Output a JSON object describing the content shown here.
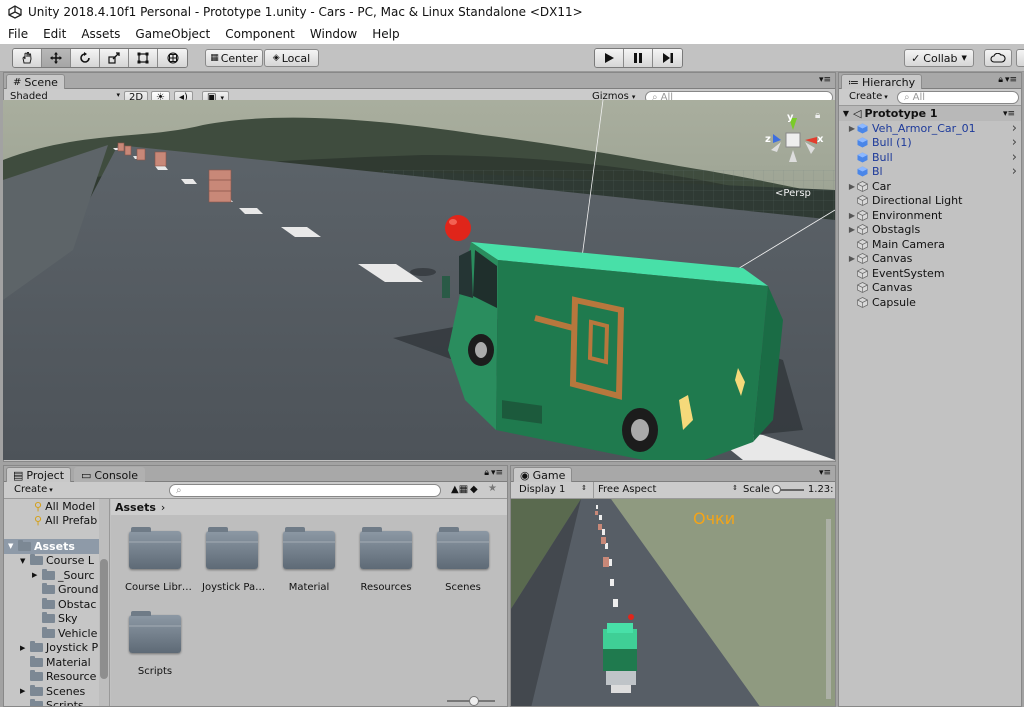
{
  "window": {
    "title": "Unity 2018.4.10f1 Personal - Prototype 1.unity - Cars - PC, Mac & Linux Standalone <DX11>"
  },
  "menu": [
    "File",
    "Edit",
    "Assets",
    "GameObject",
    "Component",
    "Window",
    "Help"
  ],
  "toolbar": {
    "pivot_label": "Center",
    "space_label": "Local",
    "collab_label": "Collab",
    "tools": [
      "hand-icon",
      "move-icon",
      "rotate-icon",
      "scale-icon",
      "rect-icon",
      "transform-icon"
    ]
  },
  "scene": {
    "tab": "Scene",
    "shading": "Shaded",
    "mode2d": "2D",
    "gizmos": "Gizmos",
    "search_placeholder": "All",
    "persp": "Persp",
    "gizmo_y": "y",
    "gizmo_x": "x",
    "gizmo_z": "z"
  },
  "hierarchy": {
    "tab": "Hierarchy",
    "create": "Create",
    "search_placeholder": "All",
    "scene_name": "Prototype 1",
    "items": [
      {
        "label": "Veh_Armor_Car_01",
        "prefab": true,
        "expand": true,
        "more": true
      },
      {
        "label": "Bull (1)",
        "prefab": true,
        "expand": false,
        "more": true
      },
      {
        "label": "Bull",
        "prefab": true,
        "expand": false,
        "more": true
      },
      {
        "label": "Bl",
        "prefab": true,
        "expand": false,
        "more": true
      },
      {
        "label": "Car",
        "prefab": false,
        "expand": true,
        "more": false
      },
      {
        "label": "Directional Light",
        "prefab": false,
        "expand": false,
        "more": false
      },
      {
        "label": "Environment",
        "prefab": false,
        "expand": true,
        "more": false
      },
      {
        "label": "Obstagls",
        "prefab": false,
        "expand": true,
        "more": false
      },
      {
        "label": "Main Camera",
        "prefab": false,
        "expand": false,
        "more": false
      },
      {
        "label": "Canvas",
        "prefab": false,
        "expand": true,
        "more": false
      },
      {
        "label": "EventSystem",
        "prefab": false,
        "expand": false,
        "more": false
      },
      {
        "label": "Canvas",
        "prefab": false,
        "expand": false,
        "more": false
      },
      {
        "label": "Capsule",
        "prefab": false,
        "expand": false,
        "more": false
      }
    ]
  },
  "project": {
    "tab": "Project",
    "console_tab": "Console",
    "create": "Create",
    "breadcrumb": "Assets",
    "favorites": [
      "All Model",
      "All Prefab"
    ],
    "tree": [
      {
        "label": "Assets",
        "level": 0,
        "arrow": "▼",
        "selected": true
      },
      {
        "label": "Course L",
        "level": 1,
        "arrow": "▼"
      },
      {
        "label": "_Sourc",
        "level": 2,
        "arrow": "▶"
      },
      {
        "label": "Ground",
        "level": 2,
        "arrow": ""
      },
      {
        "label": "Obstac",
        "level": 2,
        "arrow": ""
      },
      {
        "label": "Sky",
        "level": 2,
        "arrow": ""
      },
      {
        "label": "Vehicle",
        "level": 2,
        "arrow": ""
      },
      {
        "label": "Joystick P",
        "level": 1,
        "arrow": "▶"
      },
      {
        "label": "Material",
        "level": 1,
        "arrow": ""
      },
      {
        "label": "Resource",
        "level": 1,
        "arrow": ""
      },
      {
        "label": "Scenes",
        "level": 1,
        "arrow": "▶"
      },
      {
        "label": "Scripts",
        "level": 1,
        "arrow": ""
      }
    ],
    "folders": [
      "Course Libr…",
      "Joystick Pa…",
      "Material",
      "Resources",
      "Scenes",
      "Scripts"
    ]
  },
  "game": {
    "tab": "Game",
    "display": "Display 1",
    "aspect": "Free Aspect",
    "scale_label": "Scale",
    "scale_value": "1.23:",
    "overlay_text": "Очки"
  },
  "colors": {
    "van": "#3fcf96",
    "van_side": "#1f7a4e",
    "logo": "#b7773d",
    "ball": "#e0251a",
    "barrel": "#c88878",
    "overlay": "#f3a418"
  }
}
